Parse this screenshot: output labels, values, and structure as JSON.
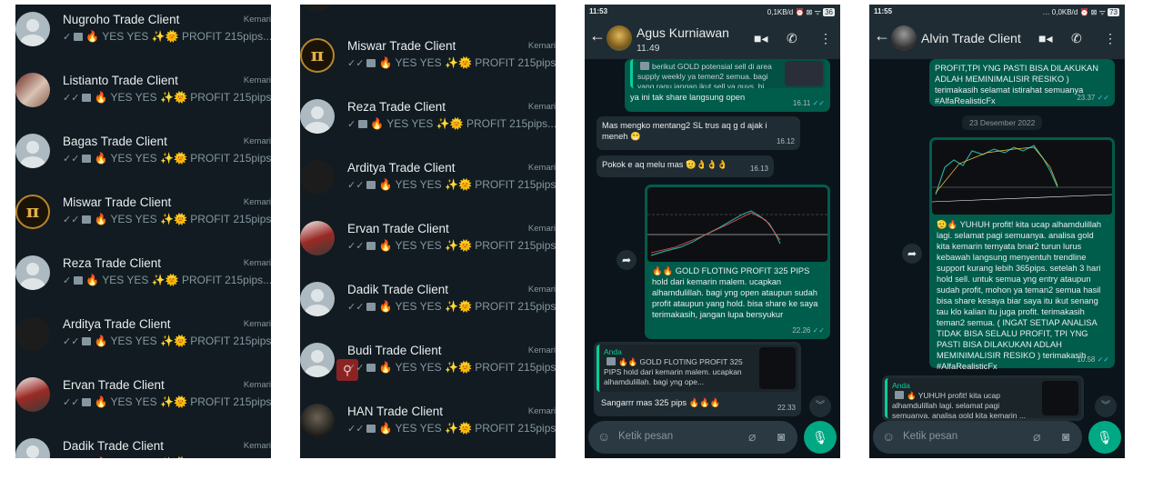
{
  "list1": {
    "items": [
      {
        "name": "Nugroho Trade Client",
        "date": "Kemari",
        "preview": "YES YES",
        "preview2": "PROFIT 215pips..."
      },
      {
        "name": "Listianto Trade Client",
        "date": "Kemari",
        "preview": "YES YES",
        "preview2": "PROFIT 215pips..."
      },
      {
        "name": "Bagas Trade Client",
        "date": "Kemari",
        "preview": "YES YES",
        "preview2": "PROFIT 215pips..."
      },
      {
        "name": "Miswar Trade Client",
        "date": "Kemari",
        "preview": "YES YES",
        "preview2": "PROFIT 215pips..."
      },
      {
        "name": "Reza Trade Client",
        "date": "Kemari",
        "preview": "YES YES",
        "preview2": "PROFIT 215pips..."
      },
      {
        "name": "Arditya Trade Client",
        "date": "Kemari",
        "preview": "YES YES",
        "preview2": "PROFIT 215pips..."
      },
      {
        "name": "Ervan Trade Client",
        "date": "Kemari",
        "preview": "YES YES",
        "preview2": "PROFIT 215pips..."
      },
      {
        "name": "Dadik Trade Client",
        "date": "Kemari",
        "preview": "YES YES",
        "preview2": "PROFIT 215pips..."
      }
    ]
  },
  "list2": {
    "items": [
      {
        "name": "Miswar Trade Client",
        "date": "Kemari",
        "preview": "YES YES",
        "preview2": "PROFIT 215pips..."
      },
      {
        "name": "Reza Trade Client",
        "date": "Kemari",
        "preview": "YES YES",
        "preview2": "PROFIT 215pips..."
      },
      {
        "name": "Arditya Trade Client",
        "date": "Kemari",
        "preview": "YES YES",
        "preview2": "PROFIT 215pips..."
      },
      {
        "name": "Ervan Trade Client",
        "date": "Kemari",
        "preview": "YES YES",
        "preview2": "PROFIT 215pips..."
      },
      {
        "name": "Dadik Trade Client",
        "date": "Kemari",
        "preview": "YES YES",
        "preview2": "PROFIT 215pips..."
      },
      {
        "name": "Budi Trade Client",
        "date": "Kemari",
        "preview": "YES YES",
        "preview2": "PROFIT 215pips..."
      },
      {
        "name": "HAN Trade Client",
        "date": "Kemari",
        "preview": "YES YES",
        "preview2": "PROFIT 215pips..."
      }
    ]
  },
  "chat1": {
    "status_time": "11:53",
    "status_right": "0,1KB/d",
    "battery": "36",
    "contact": "Agus Kurniawan",
    "last_seen": "11.49",
    "m0_quote": "berikut GOLD potensial sell di area supply weekly ya temen2 semua. bagi yang ragu jangan ikut sell ya guys. bi...",
    "m0_text": "ya ini tak share langsung open",
    "m0_time": "16.11",
    "m1_text": "Mas mengko mentang2 SL trus aq g d ajak i meneh 😁",
    "m1_time": "16.12",
    "m2_text": "Pokok e aq melu mas 🫡👌👌👌",
    "m2_time": "16.13",
    "m3_text": "🔥🔥 GOLD FLOTING PROFIT 325 PIPS hold dari kemarin malem. ucapkan alhamdulillah. bagi yng open ataupun sudah profit ataupun yang hold. bisa share ke saya terimakasih, jangan lupa bersyukur",
    "m3_time": "22.26",
    "m4_quote_author": "Anda",
    "m4_quote": "🔥🔥 GOLD FLOTING PROFIT 325 PIPS hold dari kemarin malem. ucapkan alhamdulillah. bagi yng ope...",
    "m4_text": "Sangarrr mas 325 pips 🔥🔥🔥",
    "m4_time": "22.33",
    "input_placeholder": "Ketik pesan"
  },
  "chat2": {
    "status_time": "11:55",
    "status_right": "0,0KB/d",
    "battery": "73",
    "contact": "Alvin Trade Client",
    "m0_text": "PROFIT,TPI YNG PASTI BISA DILAKUKAN ADLAH MEMINIMALISIR RESIKO ) terimakasih selamat istirahat semuanya #AlfaRealisticFx",
    "m0_time": "23.37",
    "date_chip": "23 Desember 2022",
    "m1_text": "🫡🔥 YUHUH profit! kita ucap alhamdulillah lagi. selamat pagi semuanya. analisa gold kita kemarin ternyata bnar2 turun lurus kebawah langsung menyentuh trendline support kurang lebih 365pips. setelah 3 hari hold sell. untuk semua yng entry ataupun sudah profit, mohon ya teman2 semua hasil bisa share kesaya biar saya itu ikut senang tau klo kalian itu juga profit. terimakasih teman2 semua. ( INGAT SETIAP ANALISA TIDAK BISA SELALU PROFIT, TPI YNG PASTI BISA DILAKUKAN ADLAH MEMINIMALISIR RESIKO ) terimakasih #AlfaRealisticFx",
    "m1_time": "10.58",
    "m2_quote_author": "Anda",
    "m2_quote": "🔥 YUHUH profit! kita ucap alhamdulillah lagi. selamat pagi semuanya. analisa gold kita kemarin ...",
    "input_placeholder": "Ketik pesan"
  }
}
